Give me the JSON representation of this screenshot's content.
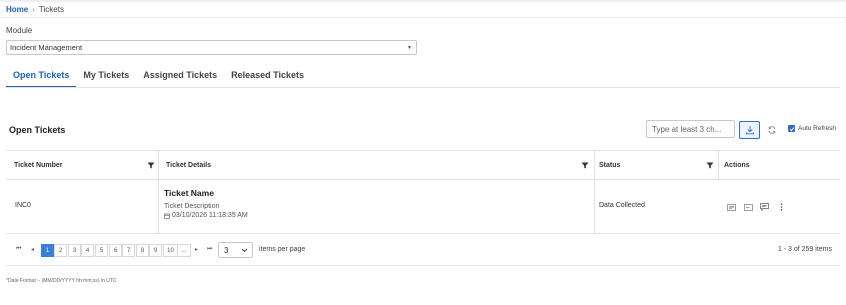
{
  "breadcrumb": {
    "home": "Home",
    "current": "Tickets"
  },
  "module": {
    "label": "Module",
    "value": "Incident Management"
  },
  "tabs": [
    {
      "label": "Open Tickets",
      "active": true
    },
    {
      "label": "My Tickets",
      "active": false
    },
    {
      "label": "Assigned Tickets",
      "active": false
    },
    {
      "label": "Released Tickets",
      "active": false
    }
  ],
  "section": {
    "title": "Open Tickets"
  },
  "toolbar": {
    "search_placeholder": "Type at least 3 ch...",
    "auto_refresh_label": "Auto Refresh",
    "auto_refresh_checked": true
  },
  "grid": {
    "columns": [
      "Ticket Number",
      "Ticket Details",
      "Status",
      "Actions"
    ],
    "rows": [
      {
        "ticket_number": "INC0",
        "ticket_name": "Ticket Name",
        "ticket_description": "Ticket Description",
        "ticket_date": "03/10/2026 11:18:35 AM",
        "status": "Data Collected"
      }
    ]
  },
  "pager": {
    "pages": [
      "1",
      "2",
      "3",
      "4",
      "5",
      "6",
      "7",
      "8",
      "9",
      "10",
      "..."
    ],
    "current_page": "1",
    "per_page": "3",
    "per_page_label": "items per page",
    "range": "1 - 3 of 259 items"
  },
  "footnote": "*Date Format :- (MM/DD/YYYY hh:mm:ss) in UTC",
  "colors": {
    "accent": "#1f5fb8",
    "active_page": "#3b7fd4"
  }
}
